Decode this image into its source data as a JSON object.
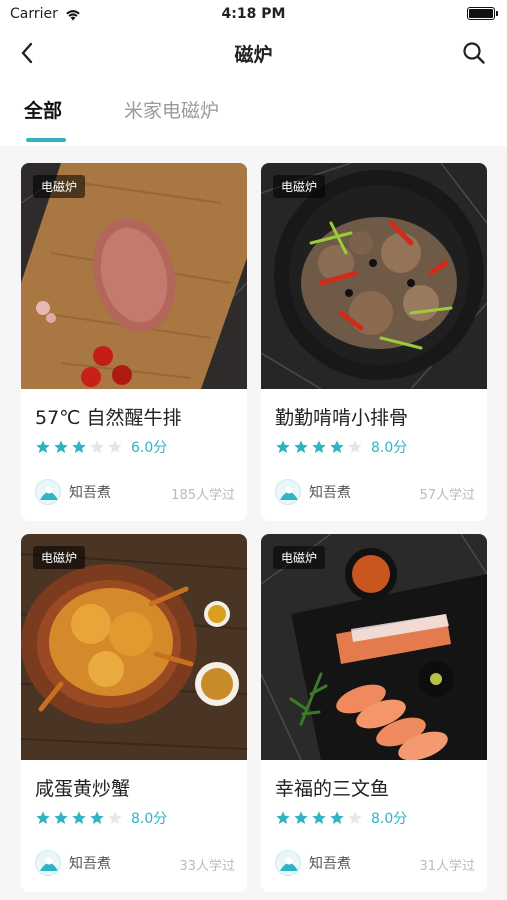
{
  "status_bar": {
    "carrier": "Carrier",
    "time": "4:18 PM",
    "battery_level": 1.0
  },
  "nav": {
    "title": "磁炉",
    "back_icon": "chevron-left-icon",
    "search_icon": "search-icon"
  },
  "tabs": [
    {
      "label": "全部",
      "active": true
    },
    {
      "label": "米家电磁炉",
      "active": false
    }
  ],
  "accent_color": "#2fb5c2",
  "recipes": [
    {
      "tag": "电磁炉",
      "title": "57℃ 自然醒牛排",
      "stars": 3,
      "max_stars": 5,
      "score": "6.0分",
      "author": "知吾煮",
      "learners": "185人学过"
    },
    {
      "tag": "电磁炉",
      "title": "勤勤啃啃小排骨",
      "stars": 4,
      "max_stars": 5,
      "score": "8.0分",
      "author": "知吾煮",
      "learners": "57人学过"
    },
    {
      "tag": "电磁炉",
      "title": "咸蛋黄炒蟹",
      "stars": 4,
      "max_stars": 5,
      "score": "8.0分",
      "author": "知吾煮",
      "learners": "33人学过"
    },
    {
      "tag": "电磁炉",
      "title": "幸福的三文鱼",
      "stars": 4,
      "max_stars": 5,
      "score": "8.0分",
      "author": "知吾煮",
      "learners": "31人学过"
    }
  ]
}
